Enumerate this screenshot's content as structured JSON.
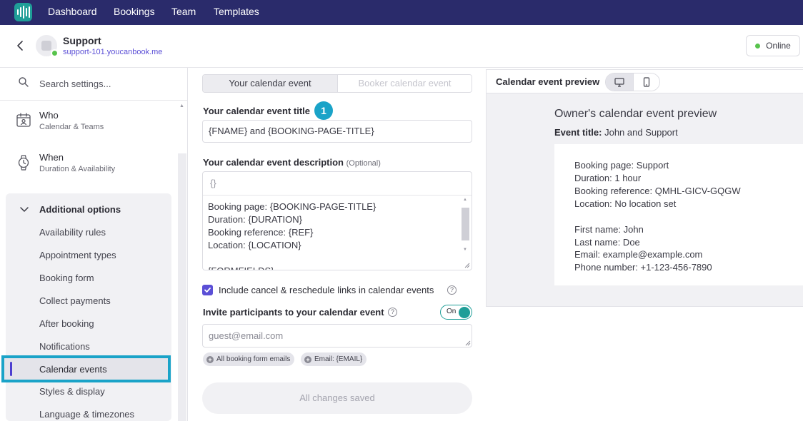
{
  "nav": {
    "items": [
      "Dashboard",
      "Bookings",
      "Team",
      "Templates"
    ]
  },
  "header": {
    "title": "Support",
    "link": "support-101.youcanbook.me",
    "status": "Online"
  },
  "sidebar": {
    "search_placeholder": "Search settings...",
    "sections": [
      {
        "title": "Who",
        "subtitle": "Calendar & Teams",
        "icon": "calendar-user-icon"
      },
      {
        "title": "When",
        "subtitle": "Duration & Availability",
        "icon": "watch-icon"
      }
    ],
    "additional": {
      "title": "Additional options",
      "items": [
        "Availability rules",
        "Appointment types",
        "Booking form",
        "Collect payments",
        "After booking",
        "Notifications",
        "Calendar events",
        "Styles & display",
        "Language & timezones"
      ],
      "active": "Calendar events"
    }
  },
  "form": {
    "tabs": [
      "Your calendar event",
      "Booker calendar event"
    ],
    "step_number": "1",
    "title_label": "Your calendar event title",
    "title_value": "{FNAME} and {BOOKING-PAGE-TITLE}",
    "desc_label": "Your calendar event description",
    "desc_optional": "(Optional)",
    "desc_token_icon": "{}",
    "desc_value": "Booking page: {BOOKING-PAGE-TITLE}\nDuration: {DURATION}\nBooking reference: {REF}\nLocation: {LOCATION}\n\n{FORMFIELDS}",
    "include_links_label": "Include cancel & reschedule links in calendar events",
    "invite_label": "Invite participants to your calendar event",
    "toggle_label": "On",
    "guest_placeholder": "guest@email.com",
    "chips": [
      "All booking form emails",
      "Email: {EMAIL}"
    ],
    "save_label": "All changes saved"
  },
  "preview": {
    "title": "Calendar event preview",
    "heading": "Owner's calendar event preview",
    "event_title_label": "Event title:",
    "event_title_value": "John and Support",
    "lines": [
      "Booking page: Support",
      "Duration: 1 hour",
      "Booking reference: QMHL-GICV-GQGW",
      "Location: No location set",
      "First name: John",
      "Last name: Doe",
      "Email: example@example.com",
      "Phone number: +1-123-456-7890"
    ]
  },
  "colors": {
    "nav_bg": "#2a2b6b",
    "brand_teal": "#1f9e98",
    "accent_purple": "#5b4fd6",
    "highlight_cyan": "#1aa3c8",
    "online_green": "#57c34c"
  }
}
